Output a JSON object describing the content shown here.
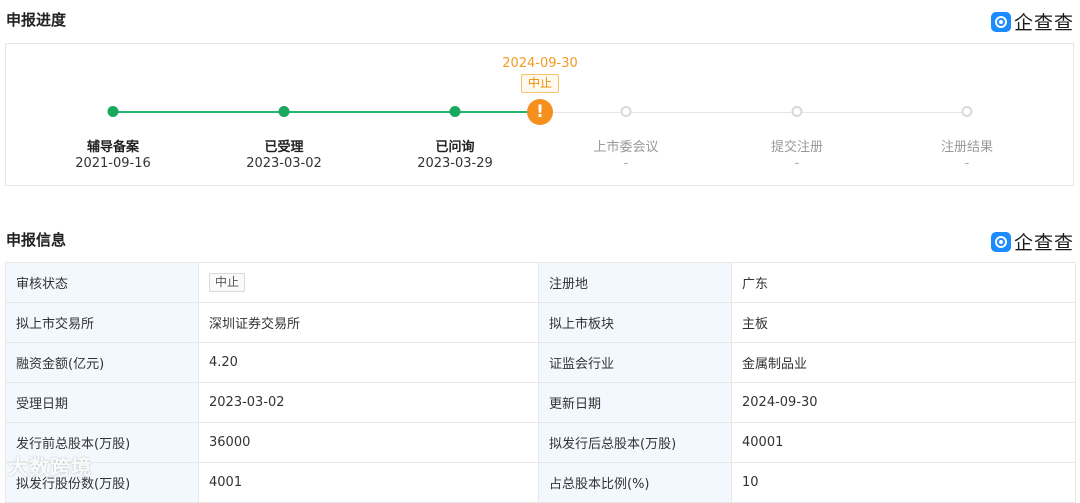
{
  "progress": {
    "title": "申报进度",
    "brand": "企查查",
    "current": {
      "date": "2024-09-30",
      "status": "中止"
    },
    "steps": [
      {
        "label": "辅导备案",
        "date": "2021-09-16",
        "state": "done"
      },
      {
        "label": "已受理",
        "date": "2023-03-02",
        "state": "done"
      },
      {
        "label": "已问询",
        "date": "2023-03-29",
        "state": "done"
      },
      {
        "label": "上市委会议",
        "date": "-",
        "state": "todo"
      },
      {
        "label": "提交注册",
        "date": "-",
        "state": "todo"
      },
      {
        "label": "注册结果",
        "date": "-",
        "state": "todo"
      }
    ]
  },
  "info": {
    "title": "申报信息",
    "brand": "企查查",
    "rows": [
      [
        "审核状态",
        "中止",
        "注册地",
        "广东"
      ],
      [
        "拟上市交易所",
        "深圳证券交易所",
        "拟上市板块",
        "主板"
      ],
      [
        "融资金额(亿元)",
        "4.20",
        "证监会行业",
        "金属制品业"
      ],
      [
        "受理日期",
        "2023-03-02",
        "更新日期",
        "2024-09-30"
      ],
      [
        "发行前总股本(万股)",
        "36000",
        "拟发行后总股本(万股)",
        "40001"
      ],
      [
        "拟发行股份数(万股)",
        "4001",
        "占总股本比例(%)",
        "10"
      ]
    ]
  },
  "watermark": "大数跨境",
  "colors": {
    "done": "#18a95e",
    "warning": "#f5901e",
    "brand": "#1a8cff"
  }
}
